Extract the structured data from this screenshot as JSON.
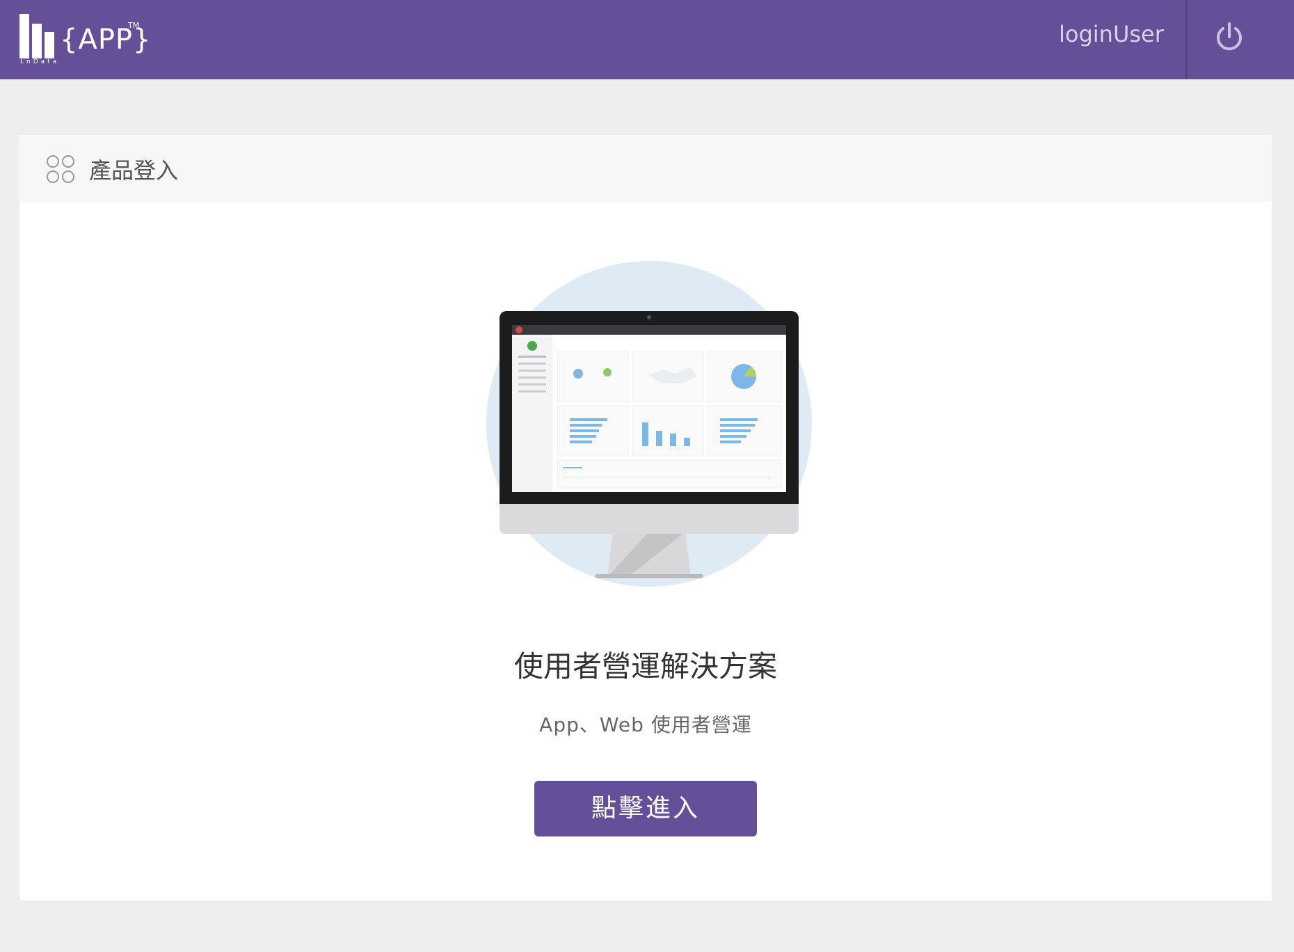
{
  "header": {
    "logo_text": "{APP}",
    "logo_tm": "TM",
    "logo_sub": "LnData",
    "username": "loginUser",
    "power_icon": "power-icon"
  },
  "card": {
    "icon": "apps-icon",
    "title": "產品登入",
    "headline": "使用者營運解決方案",
    "subline": "App、Web 使用者營運",
    "enter_label": "點擊進入"
  },
  "colors": {
    "brand": "#654f99",
    "page_bg": "#eeeeee",
    "card_bg": "#ffffff",
    "card_header_bg": "#f7f7f7",
    "illustration_circle": "#deebf4",
    "dashboard_bar": "#7db7e8"
  }
}
